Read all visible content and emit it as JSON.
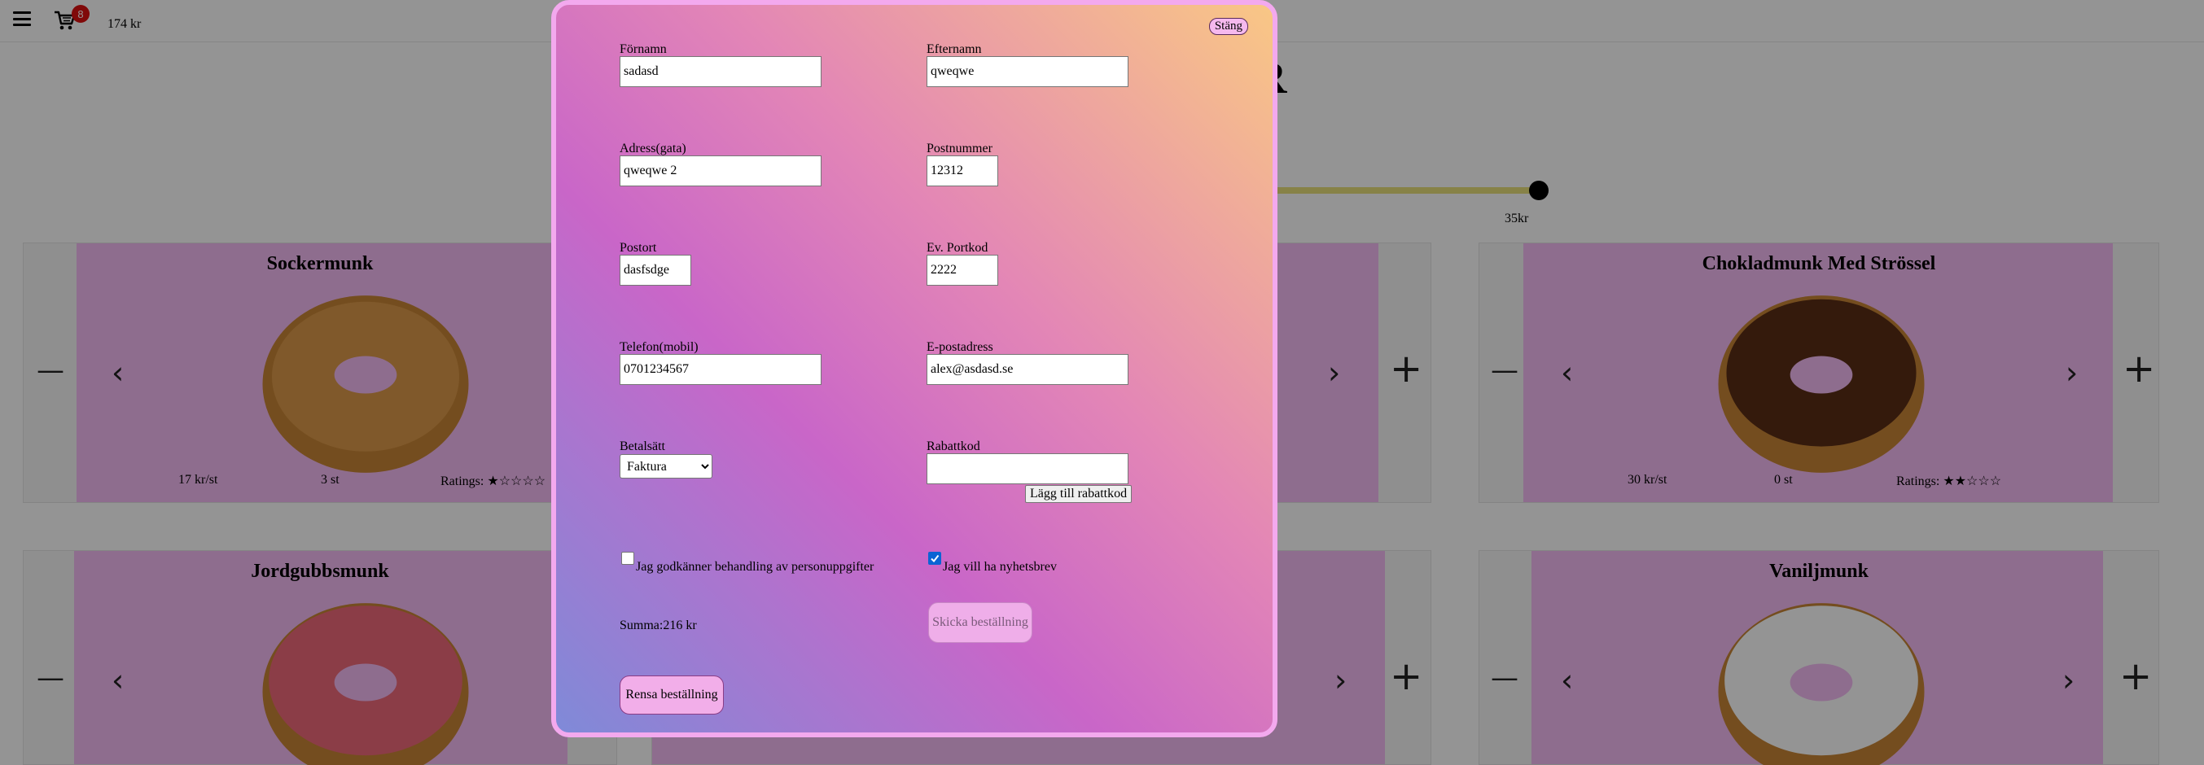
{
  "header": {
    "cart_count": "8",
    "cart_total": "174 kr"
  },
  "page": {
    "title": "R",
    "price_slider_label": "35kr"
  },
  "products": [
    {
      "name": "Sockermunk",
      "price": "17 kr/st",
      "quantity": "3 st",
      "rating_label": "Ratings:",
      "rating_stars": "★☆☆☆☆"
    },
    {
      "name": "Chokladmunk Med Strössel",
      "price": "30 kr/st",
      "quantity": "0 st",
      "rating_label": "Ratings:",
      "rating_stars": "★★☆☆☆"
    },
    {
      "name": "Jordgubbsmunk"
    },
    {
      "name": "Vaniljmunk"
    }
  ],
  "icons": {
    "minus": "—",
    "plus": "+",
    "prev": "‹",
    "next": "›"
  },
  "modal": {
    "close_label": "Stäng",
    "fields": {
      "first_name": {
        "label": "Förnamn",
        "value": "sadasd"
      },
      "last_name": {
        "label": "Efternamn",
        "value": "qweqwe"
      },
      "address": {
        "label": "Adress(gata)",
        "value": "qweqwe 2"
      },
      "postal_code": {
        "label": "Postnummer",
        "value": "12312"
      },
      "city": {
        "label": "Postort",
        "value": "dasfsdge"
      },
      "door_code": {
        "label": "Ev. Portkod",
        "value": "2222"
      },
      "phone": {
        "label": "Telefon(mobil)",
        "value": "0701234567"
      },
      "email": {
        "label": "E-postadress",
        "value": "alex@asdasd.se"
      },
      "payment": {
        "label": "Betalsätt",
        "value": "Faktura"
      },
      "discount": {
        "label": "Rabattkod",
        "value": ""
      }
    },
    "apply_discount_label": "Lägg till rabattkod",
    "consent_label": "Jag godkänner behandling av personuppgifter",
    "consent_checked": false,
    "newsletter_label": "Jag vill ha nyhetsbrev",
    "newsletter_checked": true,
    "sum_label": "Summa:216 kr",
    "submit_label": "Skicka beställning",
    "clear_label": "Rensa beställning"
  }
}
